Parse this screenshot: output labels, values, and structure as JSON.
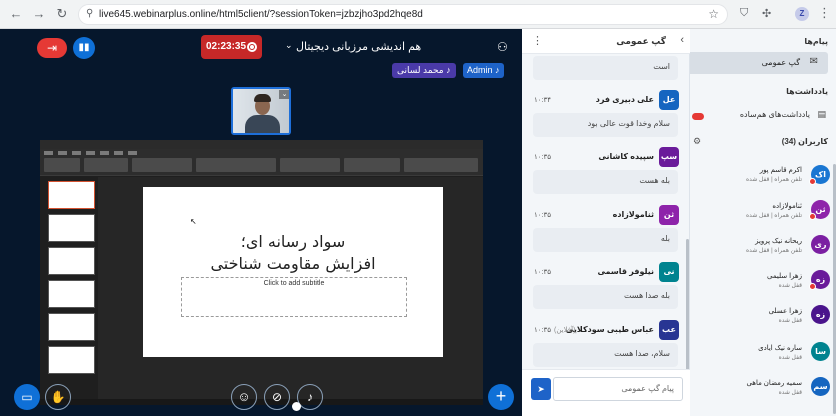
{
  "browser": {
    "url": "live645.webinarplus.online/html5client/?sessionToken=jzbzjho3pd2hqe8d",
    "profile_initial": "Z"
  },
  "header": {
    "recording_time": "02:23:35",
    "session_title": "هم اندیشی مرزبانی دیجیتال",
    "presenter_name": "محمد لسانی",
    "admin_label": "Admin"
  },
  "slide": {
    "title_line1": "سواد رسانه ای؛",
    "title_line2": "افزایش مقاومت شناختی",
    "subtitle_placeholder": "Click to add subtitle"
  },
  "chat": {
    "title": "گپ عمومی",
    "first_text": "است",
    "messages": [
      {
        "initials": "عل",
        "name": "علی دبیری فرد",
        "time": "۱۰:۳۴",
        "text": "سلام وخدا قوت عالی بود",
        "color": "#1565c0",
        "extra": ""
      },
      {
        "initials": "سپ",
        "name": "سپیده کاشانی",
        "time": "۱۰:۳۵",
        "text": "بله هست",
        "color": "#6a1b9a",
        "extra": ""
      },
      {
        "initials": "ثن",
        "name": "ثنامولازاده",
        "time": "۱۰:۳۵",
        "text": "بله",
        "color": "#8e24aa",
        "extra": ""
      },
      {
        "initials": "نی",
        "name": "نیلوفر قاسمی",
        "time": "۱۰:۳۵",
        "text": "بله صدا هست",
        "color": "#00838f",
        "extra": ""
      },
      {
        "initials": "عب",
        "name": "عباس طیبی سودکلایی",
        "time": "۱۰:۳۵",
        "text": "سلام، صدا هست",
        "color": "#283593",
        "extra": "(آفلاین)"
      }
    ],
    "input_placeholder": "پیام گپ عمومی"
  },
  "sidebar": {
    "messages_label": "پیام‌ها",
    "public_chat_label": "گپ عمومی",
    "notes_label": "یادداشت‌ها",
    "shared_notes_label": "یادداشت‌های هم‌ساده",
    "users_label": "کاربران (34)",
    "users": [
      {
        "initials": "اک",
        "name": "اکرم قاسم پور",
        "sub": "تلفن همراه | قفل شده",
        "color": "#1976d2",
        "badge": true
      },
      {
        "initials": "ثن",
        "name": "ثنامولازاده",
        "sub": "تلفن همراه | قفل شده",
        "color": "#8e24aa",
        "badge": true
      },
      {
        "initials": "ری",
        "name": "ریحانه نیک پرویز",
        "sub": "تلفن همراه | قفل شده",
        "color": "#7b1fa2",
        "badge": false
      },
      {
        "initials": "زه",
        "name": "زهرا سلیمی",
        "sub": "قفل شده",
        "color": "#6a1b9a",
        "badge": true
      },
      {
        "initials": "زه",
        "name": "زهرا عسلی",
        "sub": "قفل شده",
        "color": "#4a148c",
        "badge": false
      },
      {
        "initials": "سا",
        "name": "ساره نیک ایادی",
        "sub": "قفل شده",
        "color": "#00838f",
        "badge": false
      },
      {
        "initials": "سم",
        "name": "سمیه رمضان ماهی",
        "sub": "قفل شده",
        "color": "#1565c0",
        "badge": false
      }
    ]
  }
}
